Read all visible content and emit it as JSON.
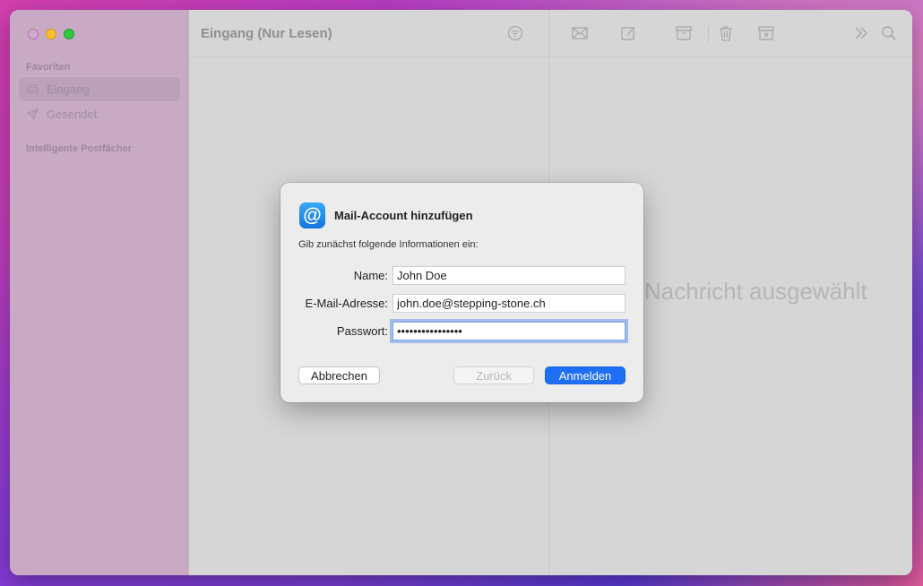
{
  "sidebar": {
    "section_favorites": "Favoriten",
    "items": [
      {
        "label": "Eingang",
        "icon": "tray-icon"
      },
      {
        "label": "Gesendet",
        "icon": "paper-plane-icon"
      }
    ],
    "section_smart": "Intelligente Postfächer"
  },
  "list": {
    "title": "Eingang (Nur Lesen)"
  },
  "detail": {
    "empty_message": "Nachricht ausgewählt"
  },
  "dialog": {
    "title": "Mail-Account hinzufügen",
    "subtitle": "Gib zunächst folgende Informationen ein:",
    "name_label": "Name:",
    "name_value": "John Doe",
    "email_label": "E-Mail-Adresse:",
    "email_value": "john.doe@stepping-stone.ch",
    "password_label": "Passwort:",
    "password_value": "••••••••••••••••",
    "cancel_label": "Abbrechen",
    "back_label": "Zurück",
    "login_label": "Anmelden"
  },
  "colors": {
    "accent": "#1e6ff5",
    "focus": "#7ea6e8"
  }
}
